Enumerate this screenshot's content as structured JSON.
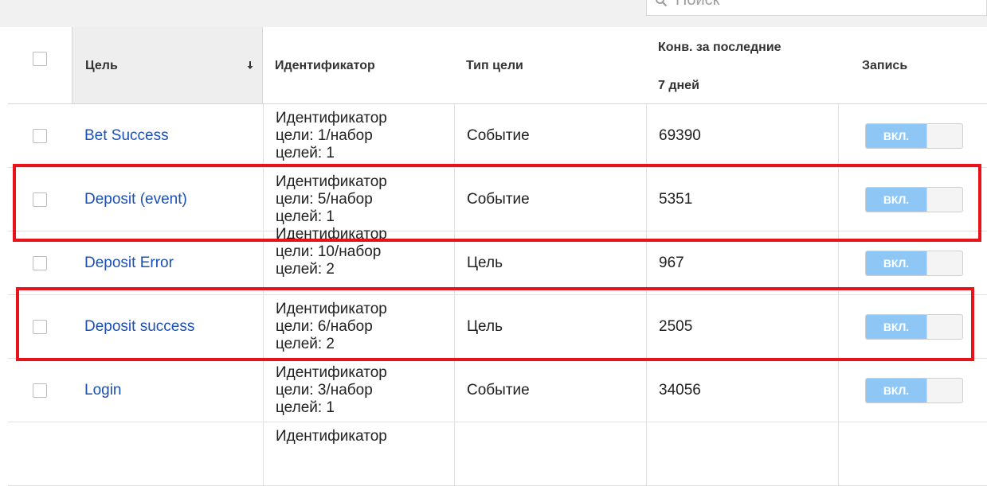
{
  "search": {
    "placeholder": "Поиск"
  },
  "header": {
    "goal": "Цель",
    "identifier": "Идентификатор",
    "goal_type": "Тип цели",
    "conv_line1": "Конв. за последние",
    "conv_line2": "7 дней",
    "recording": "Запись"
  },
  "rows": [
    {
      "name": "Bet Success",
      "id_l1": "Идентификатор",
      "id_l2": "цели: 1/набор",
      "id_l3": "целей: 1",
      "type": "Событие",
      "conversions": "69390",
      "toggle": "ВКЛ."
    },
    {
      "name": "Deposit (event)",
      "id_l1": "Идентификатор",
      "id_l2": "цели: 5/набор",
      "id_l3": "целей: 1",
      "type": "Событие",
      "conversions": "5351",
      "toggle": "ВКЛ."
    },
    {
      "name": "Deposit Error",
      "id_l1": "Идентификатор",
      "id_l2": "цели: 10/набор",
      "id_l3": "целей: 2",
      "type": "Цель",
      "conversions": "967",
      "toggle": "ВКЛ."
    },
    {
      "name": "Deposit success",
      "id_l1": "Идентификатор",
      "id_l2": "цели: 6/набор",
      "id_l3": "целей: 2",
      "type": "Цель",
      "conversions": "2505",
      "toggle": "ВКЛ."
    },
    {
      "name": "Login",
      "id_l1": "Идентификатор",
      "id_l2": "цели: 3/набор",
      "id_l3": "целей: 1",
      "type": "Событие",
      "conversions": "34056",
      "toggle": "ВКЛ."
    },
    {
      "id_l1": "Идентификатор"
    }
  ],
  "colors": {
    "link": "#1a4fb8",
    "toggle_on": "#8ec7f5",
    "highlight": "#e8121b"
  }
}
